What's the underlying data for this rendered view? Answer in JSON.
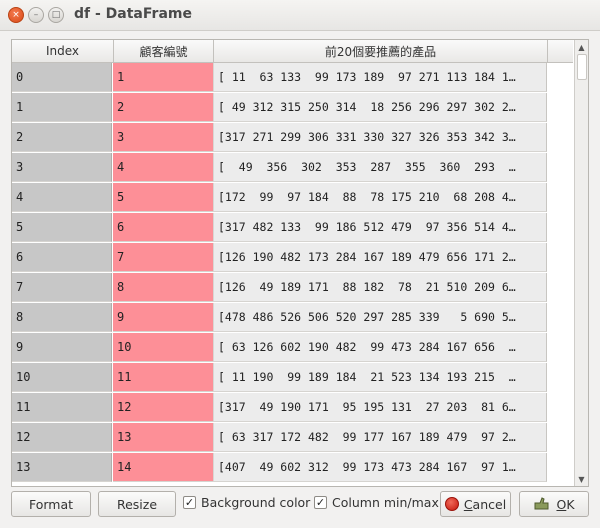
{
  "window": {
    "title": "df - DataFrame",
    "close_glyph": "×",
    "min_glyph": "–",
    "max_glyph": "□"
  },
  "table": {
    "headers": [
      "Index",
      "顧客編號",
      "前20個要推薦的產品"
    ],
    "rows": [
      {
        "index": "0",
        "customer": "1",
        "products": "[ 11  63 133  99 173 189  97 271 113 184 1…"
      },
      {
        "index": "1",
        "customer": "2",
        "products": "[ 49 312 315 250 314  18 256 296 297 302 2…"
      },
      {
        "index": "2",
        "customer": "3",
        "products": "[317 271 299 306 331 330 327 326 353 342 3…"
      },
      {
        "index": "3",
        "customer": "4",
        "products": "[  49  356  302  353  287  355  360  293  …"
      },
      {
        "index": "4",
        "customer": "5",
        "products": "[172  99  97 184  88  78 175 210  68 208 4…"
      },
      {
        "index": "5",
        "customer": "6",
        "products": "[317 482 133  99 186 512 479  97 356 514 4…"
      },
      {
        "index": "6",
        "customer": "7",
        "products": "[126 190 482 173 284 167 189 479 656 171 2…"
      },
      {
        "index": "7",
        "customer": "8",
        "products": "[126  49 189 171  88 182  78  21 510 209 6…"
      },
      {
        "index": "8",
        "customer": "9",
        "products": "[478 486 526 506 520 297 285 339   5 690 5…"
      },
      {
        "index": "9",
        "customer": "10",
        "products": "[ 63 126 602 190 482  99 473 284 167 656  …"
      },
      {
        "index": "10",
        "customer": "11",
        "products": "[ 11 190  99 189 184  21 523 134 193 215  …"
      },
      {
        "index": "11",
        "customer": "12",
        "products": "[317  49 190 171  95 195 131  27 203  81 6…"
      },
      {
        "index": "12",
        "customer": "13",
        "products": "[ 63 317 172 482  99 177 167 189 479  97 2…"
      },
      {
        "index": "13",
        "customer": "14",
        "products": "[407  49 602 312  99 173 473 284 167  97 1…"
      }
    ]
  },
  "buttons": {
    "format": "Format",
    "resize": "Resize",
    "cancel": "Cancel",
    "ok": "OK"
  },
  "checkboxes": {
    "background_color": {
      "label": "Background color",
      "checked": true
    },
    "column_minmax": {
      "label": "Column min/max",
      "checked": true
    }
  },
  "scrollbar": {
    "up": "▲",
    "down": "▼"
  },
  "icons": {
    "check": "✓",
    "cancel": "cancel-circle-icon",
    "ok": "ok-thumb-icon"
  },
  "colors": {
    "index_bg": "#c7c7c7",
    "customer_bg": "#fd8f97",
    "products_bg": "#ececec",
    "close_button": "#e4572e"
  }
}
